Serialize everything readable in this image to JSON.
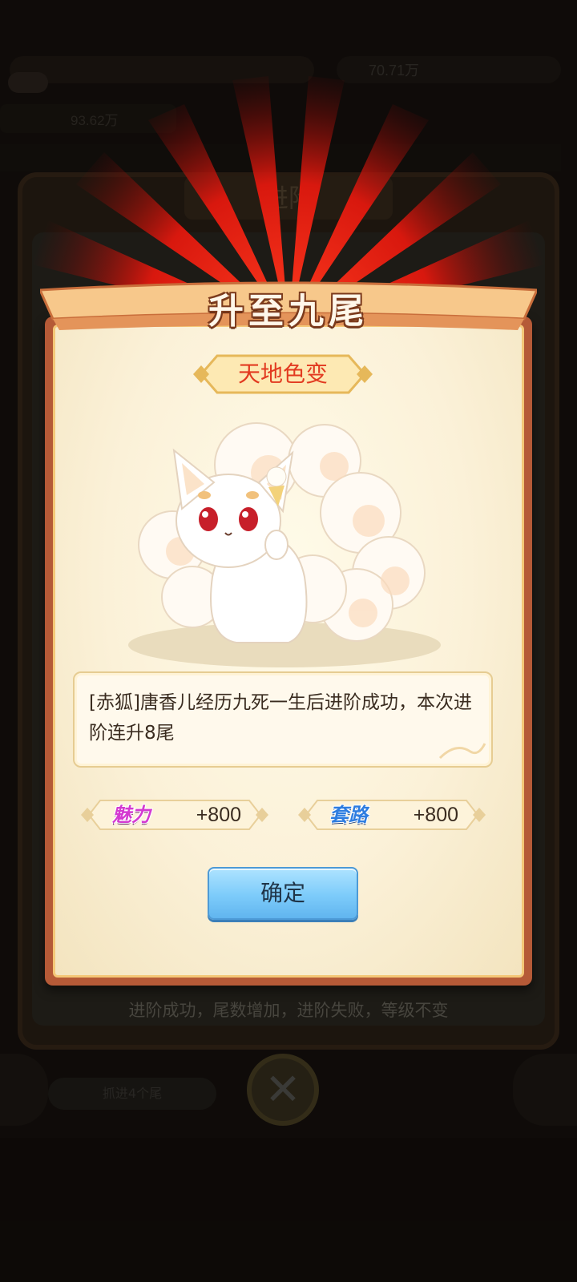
{
  "background": {
    "resource_value": "70.71万",
    "row_value": "93.62万",
    "panel_title": "进阶",
    "hint": "进阶成功，尾数增加，进阶失败，等级不变",
    "bottom_button_label": "抓进4个尾"
  },
  "dialog": {
    "title": "升至九尾",
    "subtitle": "天地色变",
    "description": "[赤狐]唐香儿经历九死一生后进阶成功，本次进阶连升8尾",
    "stats": [
      {
        "label": "魅力",
        "value": "+800",
        "color": "#d43ad1"
      },
      {
        "label": "套路",
        "value": "+800",
        "color": "#2e7de0"
      }
    ],
    "confirm_label": "确定"
  },
  "icons": {
    "close": "close-icon",
    "fox": "nine-tailed-fox-illustration"
  },
  "colors": {
    "frame": "#b55a37",
    "subtitle": "#e23a20",
    "confirm": "#7ccbfa"
  }
}
